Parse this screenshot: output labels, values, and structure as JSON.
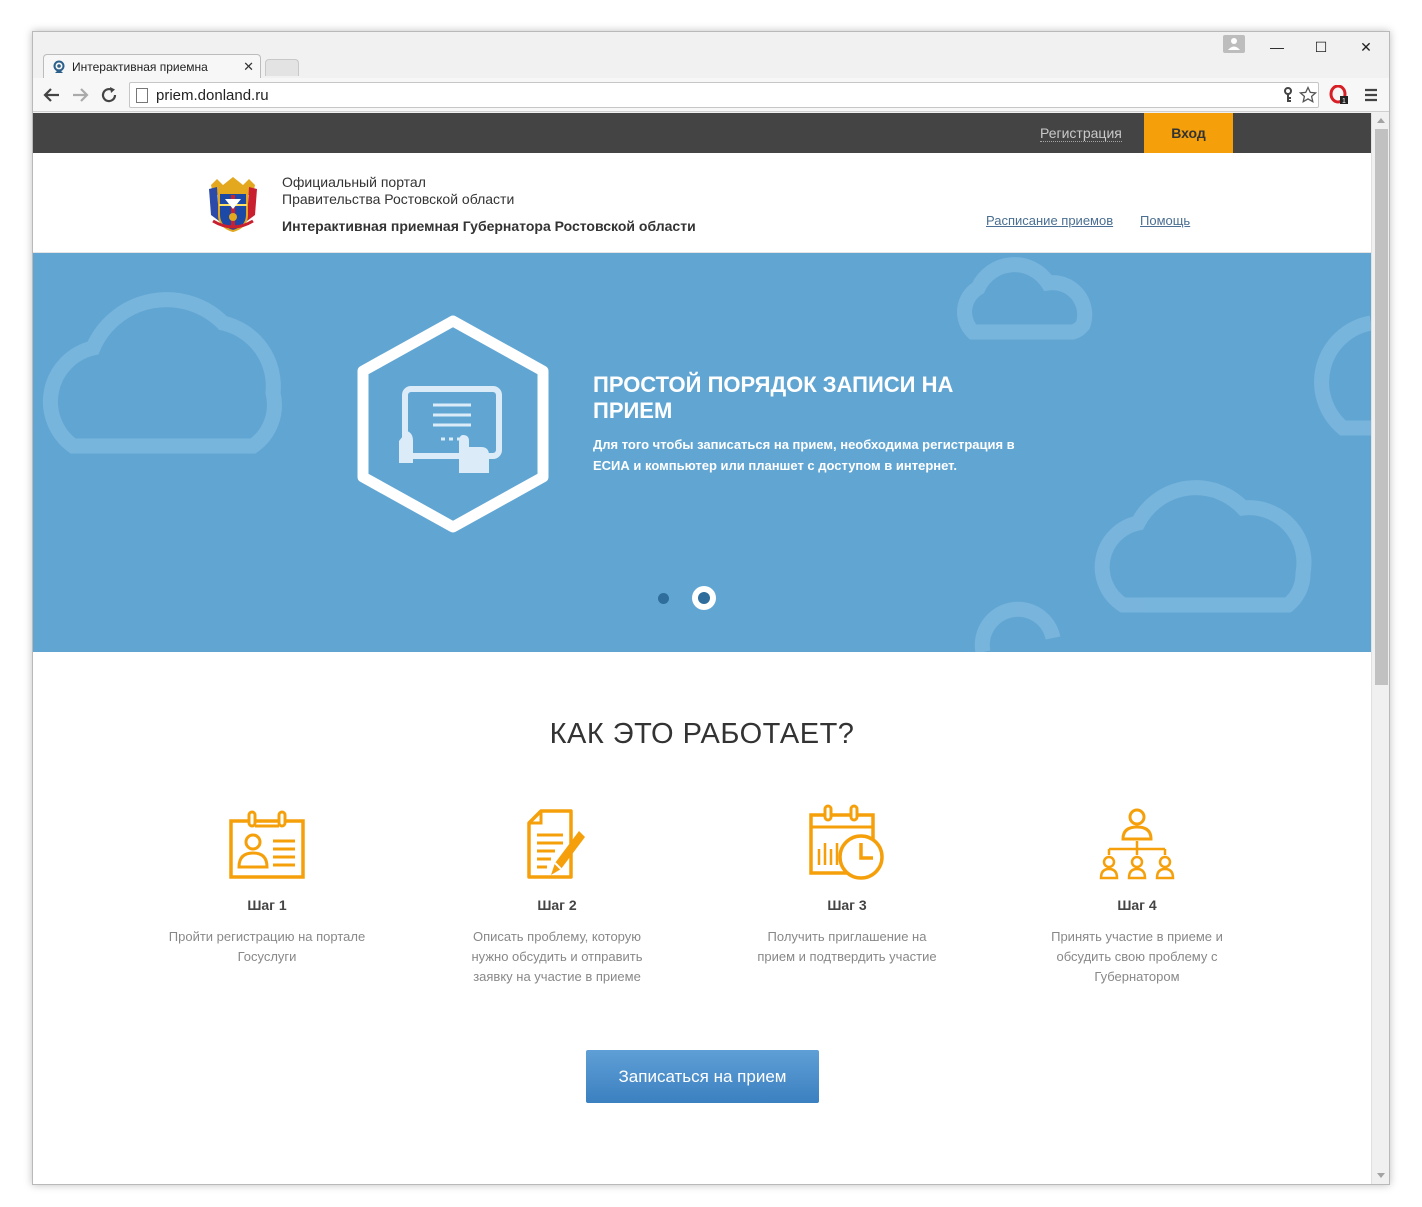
{
  "browser": {
    "tab_title": "Интерактивная приемна",
    "tab_close": "✕",
    "url": "priem.donland.ru",
    "window_controls": {
      "minimize": "—",
      "maximize": "☐",
      "close": "✕"
    }
  },
  "topbar": {
    "register_label": "Регистрация",
    "login_label": "Вход"
  },
  "header": {
    "portal_line1": "Официальный портал",
    "portal_line2": "Правительства Ростовской области",
    "title": "Интерактивная приемная Губернатора Ростовской области",
    "nav": [
      "Расписание приемов",
      "Помощь"
    ]
  },
  "hero": {
    "title": "ПРОСТОЙ ПОРЯДОК ЗАПИСИ НА ПРИЕМ",
    "text": "Для того чтобы записаться на прием, необходима регистрация в ЕСИА и компьютер или планшет с доступом в интернет.",
    "slides_count": 2,
    "active_slide": 2
  },
  "how": {
    "title": "КАК ЭТО РАБОТАЕТ?",
    "steps": [
      {
        "title": "Шаг 1",
        "text": "Пройти регистрацию на портале Госуслуги",
        "icon": "id-card-icon"
      },
      {
        "title": "Шаг 2",
        "text": "Описать проблему, которую нужно обсудить и отправить заявку на участие в приеме",
        "icon": "document-pencil-icon"
      },
      {
        "title": "Шаг 3",
        "text": "Получить приглашение на прием и подтвердить участие",
        "icon": "calendar-clock-icon"
      },
      {
        "title": "Шаг 4",
        "text": "Принять участие в приеме и обсудить свою проблему с Губернатором",
        "icon": "people-hierarchy-icon"
      }
    ]
  },
  "cta_label": "Записаться на прием",
  "colors": {
    "accent": "#f5a00b",
    "hero_bg": "#61a6d3",
    "topbar": "#444444",
    "button": "#3d85c6"
  }
}
